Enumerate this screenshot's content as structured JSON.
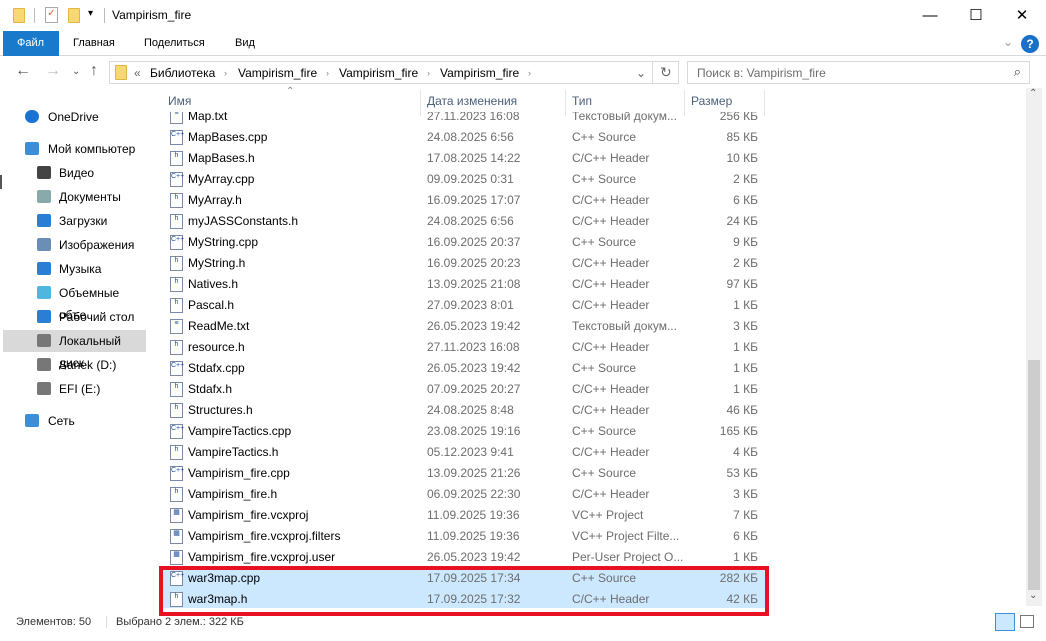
{
  "window": {
    "title": "Vampirism_fire",
    "minimize": "—",
    "maximize": "☐",
    "close": "✕"
  },
  "ribbon": {
    "tabs": [
      "Файл",
      "Главная",
      "Поделиться",
      "Вид"
    ],
    "help": "?",
    "expand": "⌄"
  },
  "address": {
    "prefix": "«",
    "crumbs": [
      "Библиотека",
      "Vampirism_fire",
      "Vampirism_fire",
      "Vampirism_fire"
    ]
  },
  "search": {
    "placeholder": "Поиск в: Vampirism_fire"
  },
  "sidebar": {
    "items": [
      {
        "label": "OneDrive",
        "icon": "cloud-icon",
        "color": "#1a73d0"
      },
      {
        "label": "Мой компьютер",
        "icon": "computer-icon",
        "color": "#3c8fd6"
      },
      {
        "label": "Видео",
        "icon": "video-icon",
        "color": "#444"
      },
      {
        "label": "Документы",
        "icon": "documents-icon",
        "color": "#8aa"
      },
      {
        "label": "Загрузки",
        "icon": "downloads-icon",
        "color": "#2a7fd4"
      },
      {
        "label": "Изображения",
        "icon": "pictures-icon",
        "color": "#6a8eb5"
      },
      {
        "label": "Музыка",
        "icon": "music-icon",
        "color": "#2a7fd4"
      },
      {
        "label": "Объемные объе",
        "icon": "3d-objects-icon",
        "color": "#4fb6e0"
      },
      {
        "label": "Рабочий стол",
        "icon": "desktop-icon",
        "color": "#2a7fd4"
      },
      {
        "label": "Локальный диск",
        "icon": "drive-icon",
        "color": "#777"
      },
      {
        "label": "Sanek (D:)",
        "icon": "drive-icon",
        "color": "#777"
      },
      {
        "label": "EFI (E:)",
        "icon": "drive-icon",
        "color": "#777"
      },
      {
        "label": "Сеть",
        "icon": "network-icon",
        "color": "#3c8fd6"
      }
    ]
  },
  "columns": {
    "name": "Имя",
    "date": "Дата изменения",
    "type": "Тип",
    "size": "Размер"
  },
  "files": [
    {
      "name": "Map.txt",
      "date": "27.11.2023 16:08",
      "type": "Текстовый докум...",
      "size": "256 КБ",
      "kind": "txt"
    },
    {
      "name": "MapBases.cpp",
      "date": "24.08.2025 6:56",
      "type": "C++ Source",
      "size": "85 КБ",
      "kind": "cpp"
    },
    {
      "name": "MapBases.h",
      "date": "17.08.2025 14:22",
      "type": "C/C++ Header",
      "size": "10 КБ",
      "kind": "h"
    },
    {
      "name": "MyArray.cpp",
      "date": "09.09.2025 0:31",
      "type": "C++ Source",
      "size": "2 КБ",
      "kind": "cpp"
    },
    {
      "name": "MyArray.h",
      "date": "16.09.2025 17:07",
      "type": "C/C++ Header",
      "size": "6 КБ",
      "kind": "h"
    },
    {
      "name": "myJASSConstants.h",
      "date": "24.08.2025 6:56",
      "type": "C/C++ Header",
      "size": "24 КБ",
      "kind": "h"
    },
    {
      "name": "MyString.cpp",
      "date": "16.09.2025 20:37",
      "type": "C++ Source",
      "size": "9 КБ",
      "kind": "cpp"
    },
    {
      "name": "MyString.h",
      "date": "16.09.2025 20:23",
      "type": "C/C++ Header",
      "size": "2 КБ",
      "kind": "h"
    },
    {
      "name": "Natives.h",
      "date": "13.09.2025 21:08",
      "type": "C/C++ Header",
      "size": "97 КБ",
      "kind": "h"
    },
    {
      "name": "Pascal.h",
      "date": "27.09.2023 8:01",
      "type": "C/C++ Header",
      "size": "1 КБ",
      "kind": "h"
    },
    {
      "name": "ReadMe.txt",
      "date": "26.05.2023 19:42",
      "type": "Текстовый докум...",
      "size": "3 КБ",
      "kind": "txt"
    },
    {
      "name": "resource.h",
      "date": "27.11.2023 16:08",
      "type": "C/C++ Header",
      "size": "1 КБ",
      "kind": "h"
    },
    {
      "name": "Stdafx.cpp",
      "date": "26.05.2023 19:42",
      "type": "C++ Source",
      "size": "1 КБ",
      "kind": "cpp"
    },
    {
      "name": "Stdafx.h",
      "date": "07.09.2025 20:27",
      "type": "C/C++ Header",
      "size": "1 КБ",
      "kind": "h"
    },
    {
      "name": "Structures.h",
      "date": "24.08.2025 8:48",
      "type": "C/C++ Header",
      "size": "46 КБ",
      "kind": "h"
    },
    {
      "name": "VampireTactics.cpp",
      "date": "23.08.2025 19:16",
      "type": "C++ Source",
      "size": "165 КБ",
      "kind": "cpp"
    },
    {
      "name": "VampireTactics.h",
      "date": "05.12.2023 9:41",
      "type": "C/C++ Header",
      "size": "4 КБ",
      "kind": "h"
    },
    {
      "name": "Vampirism_fire.cpp",
      "date": "13.09.2025 21:26",
      "type": "C++ Source",
      "size": "53 КБ",
      "kind": "cpp"
    },
    {
      "name": "Vampirism_fire.h",
      "date": "06.09.2025 22:30",
      "type": "C/C++ Header",
      "size": "3 КБ",
      "kind": "h"
    },
    {
      "name": "Vampirism_fire.vcxproj",
      "date": "11.09.2025 19:36",
      "type": "VC++ Project",
      "size": "7 КБ",
      "kind": "proj"
    },
    {
      "name": "Vampirism_fire.vcxproj.filters",
      "date": "11.09.2025 19:36",
      "type": "VC++ Project Filte...",
      "size": "6 КБ",
      "kind": "proj"
    },
    {
      "name": "Vampirism_fire.vcxproj.user",
      "date": "26.05.2023 19:42",
      "type": "Per-User Project O...",
      "size": "1 КБ",
      "kind": "proj"
    },
    {
      "name": "war3map.cpp",
      "date": "17.09.2025 17:34",
      "type": "C++ Source",
      "size": "282 КБ",
      "kind": "cpp",
      "selected": true
    },
    {
      "name": "war3map.h",
      "date": "17.09.2025 17:32",
      "type": "C/C++ Header",
      "size": "42 КБ",
      "kind": "h",
      "selected": true
    }
  ],
  "status": {
    "count": "Элементов: 50",
    "selected": "Выбрано 2 элем.: 322 КБ"
  },
  "colors": {
    "accent": "#1979ca",
    "selection": "#cce8ff",
    "highlight": "#e81123"
  }
}
